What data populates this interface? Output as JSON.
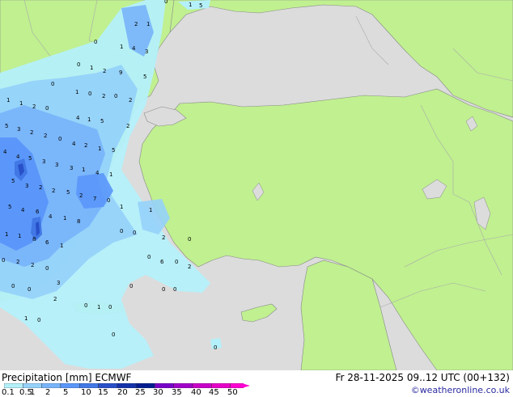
{
  "footer": {
    "title": "Precipitation [mm]  ECMWF",
    "run": "Fr 28-11-2025 09..12 UTC (00+132)",
    "credit": "©weatheronline.co.uk"
  },
  "legend": {
    "labels": [
      "0.1",
      "0.5",
      "1",
      "2",
      "5",
      "10",
      "15",
      "20",
      "25",
      "30",
      "35",
      "40",
      "45",
      "50"
    ],
    "colors": [
      "#b4f0fa",
      "#96d2fa",
      "#78b4fa",
      "#5a96fa",
      "#4178e6",
      "#2850c8",
      "#1432aa",
      "#001c90",
      "#7800c8",
      "#a000c8",
      "#c800c8",
      "#e600c8",
      "#ff00d2"
    ]
  },
  "map": {
    "colors": {
      "land": "#c0f090",
      "sea": "#dcdcdc",
      "border": "#aaaaaa",
      "coast": "#888888"
    },
    "values": [
      "0",
      "1",
      "2",
      "3",
      "4",
      "5",
      "6",
      "7",
      "8",
      "9"
    ]
  }
}
